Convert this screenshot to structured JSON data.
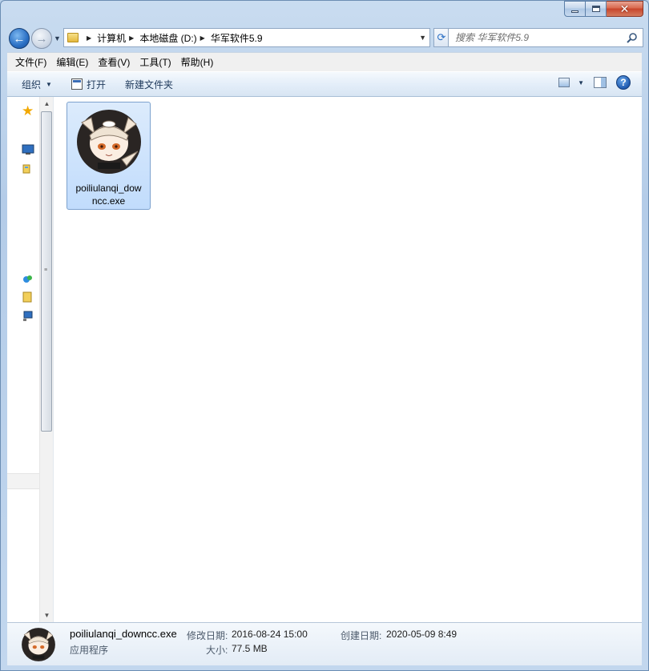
{
  "nav": {
    "breadcrumbs": [
      "计算机",
      "本地磁盘 (D:)",
      "华军软件5.9"
    ]
  },
  "search": {
    "placeholder": "搜索 华军软件5.9"
  },
  "menubar": {
    "items": [
      "文件(F)",
      "编辑(E)",
      "查看(V)",
      "工具(T)",
      "帮助(H)"
    ]
  },
  "toolbar": {
    "organize_label": "组织",
    "open_label": "打开",
    "new_folder_label": "新建文件夹"
  },
  "files": [
    {
      "name": "poiliulanqi_downcc.exe",
      "display_name": "poiliulanqi_downcc.exe"
    }
  ],
  "details": {
    "name": "poiliulanqi_downcc.exe",
    "type": "应用程序",
    "modified_label": "修改日期:",
    "modified_value": "2016-08-24 15:00",
    "created_label": "创建日期:",
    "created_value": "2020-05-09 8:49",
    "size_label": "大小:",
    "size_value": "77.5 MB"
  },
  "colors": {
    "accent": "#2a6fc4",
    "selection": "#c1dcfc",
    "close_button": "#c7452b"
  },
  "icons": {
    "back": "back-arrow-icon",
    "forward": "forward-arrow-icon",
    "refresh": "refresh-icon",
    "search": "search-icon",
    "help": "help-icon"
  }
}
